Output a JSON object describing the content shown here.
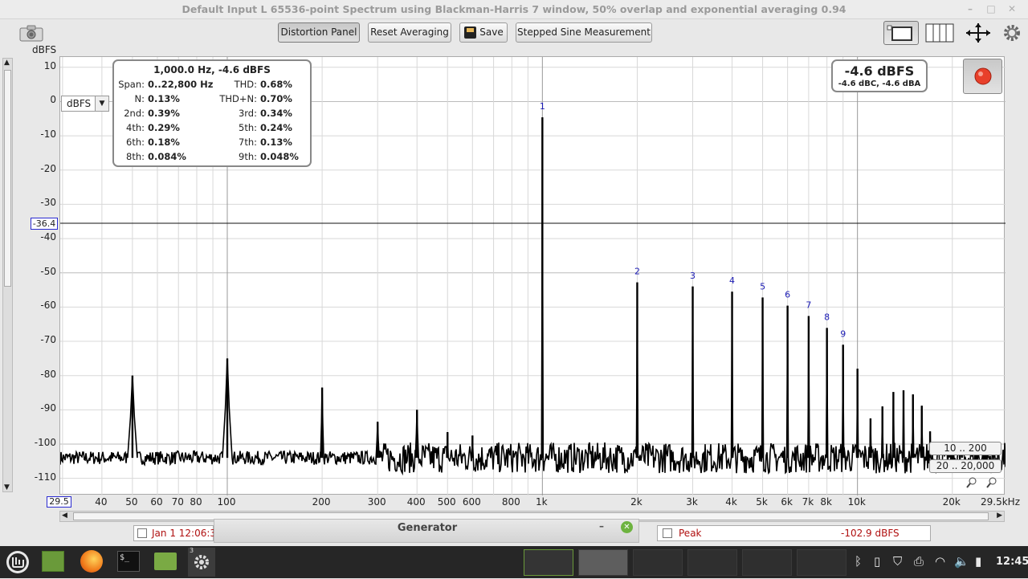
{
  "window_title": "Default Input L 65536-point Spectrum using Blackman-Harris 7 window, 50% overlap and exponential averaging 0.94",
  "window_controls": {
    "minimize": "–",
    "maximize": "□",
    "close": "✕"
  },
  "toolbar": {
    "distortion_panel": "Distortion Panel",
    "reset_averaging": "Reset Averaging",
    "save": "Save",
    "stepped_sine": "Stepped Sine Measurement"
  },
  "y_axis": {
    "unit_label": "dBFS",
    "unit_select": "dBFS",
    "cursor_value": "-36.4"
  },
  "y_ticks": [
    "10",
    "0",
    "-10",
    "-20",
    "-30",
    "-40",
    "-50",
    "-60",
    "-70",
    "-80",
    "-90",
    "-100",
    "-110"
  ],
  "x_ticks": [
    "40",
    "50",
    "60",
    "70",
    "80",
    "100",
    "200",
    "300",
    "400",
    "500",
    "600",
    "800",
    "1k",
    "2k",
    "3k",
    "4k",
    "5k",
    "6k",
    "7k",
    "8k",
    "10k",
    "20k"
  ],
  "x_min_label": "29.5",
  "x_max_label": "29.5kHz",
  "distortion": {
    "header": "1,000.0 Hz, -4.6 dBFS",
    "rows": [
      {
        "l1": "Span:",
        "v1": "0..22,800 Hz",
        "l2": "THD:",
        "v2": "0.68%"
      },
      {
        "l1": "N:",
        "v1": "0.13%",
        "l2": "THD+N:",
        "v2": "0.70%"
      },
      {
        "l1": "2nd:",
        "v1": "0.39%",
        "l2": "3rd:",
        "v2": "0.34%"
      },
      {
        "l1": "4th:",
        "v1": "0.29%",
        "l2": "5th:",
        "v2": "0.24%"
      },
      {
        "l1": "6th:",
        "v1": "0.18%",
        "l2": "7th:",
        "v2": "0.13%"
      },
      {
        "l1": "8th:",
        "v1": "0.084%",
        "l2": "9th:",
        "v2": "0.048%"
      }
    ]
  },
  "level": {
    "main": "-4.6 dBFS",
    "sub": "-4.6 dBC, -4.6 dBA"
  },
  "range_y": "10 .. 200",
  "range_x": "20 .. 20,000",
  "legend": {
    "left_entry": "Jan 1 12:06:3",
    "generator": "Generator",
    "gen_min": "–",
    "peak_label": "Peak",
    "peak_value": "-102.9 dBFS"
  },
  "taskbar": {
    "clock": "12:45",
    "badge": "3"
  },
  "colors": {
    "trace": "#000000",
    "marker": "#1a1ab4",
    "record": "#e8402a"
  },
  "chart_data": {
    "type": "line",
    "title": "",
    "xlabel": "",
    "ylabel": "dBFS",
    "x_scale": "log",
    "xlim": [
      29.5,
      29500
    ],
    "ylim": [
      -115,
      13
    ],
    "grid": true,
    "noise_floor": -104,
    "peaks": [
      {
        "x": 50,
        "y": -80
      },
      {
        "x": 100,
        "y": -75
      },
      {
        "x": 200,
        "y": -83.5
      },
      {
        "x": 300,
        "y": -93.5
      },
      {
        "x": 400,
        "y": -90
      },
      {
        "x": 500,
        "y": -96.5
      },
      {
        "x": 600,
        "y": -97.5
      },
      {
        "x": 1000,
        "y": -4.6,
        "label": "1"
      },
      {
        "x": 2000,
        "y": -52.8,
        "label": "2"
      },
      {
        "x": 3000,
        "y": -54,
        "label": "3"
      },
      {
        "x": 4000,
        "y": -55.5,
        "label": "4"
      },
      {
        "x": 5000,
        "y": -57.2,
        "label": "5"
      },
      {
        "x": 6000,
        "y": -59.6,
        "label": "6"
      },
      {
        "x": 7000,
        "y": -62.6,
        "label": "7"
      },
      {
        "x": 8000,
        "y": -66.1,
        "label": "8"
      },
      {
        "x": 9000,
        "y": -71,
        "label": "9"
      },
      {
        "x": 10000,
        "y": -78
      },
      {
        "x": 11000,
        "y": -92.5
      },
      {
        "x": 12000,
        "y": -89
      },
      {
        "x": 13000,
        "y": -84.8
      },
      {
        "x": 14000,
        "y": -84.3
      },
      {
        "x": 15000,
        "y": -85.5
      },
      {
        "x": 16000,
        "y": -88.8
      },
      {
        "x": 17000,
        "y": -96.3
      }
    ]
  }
}
